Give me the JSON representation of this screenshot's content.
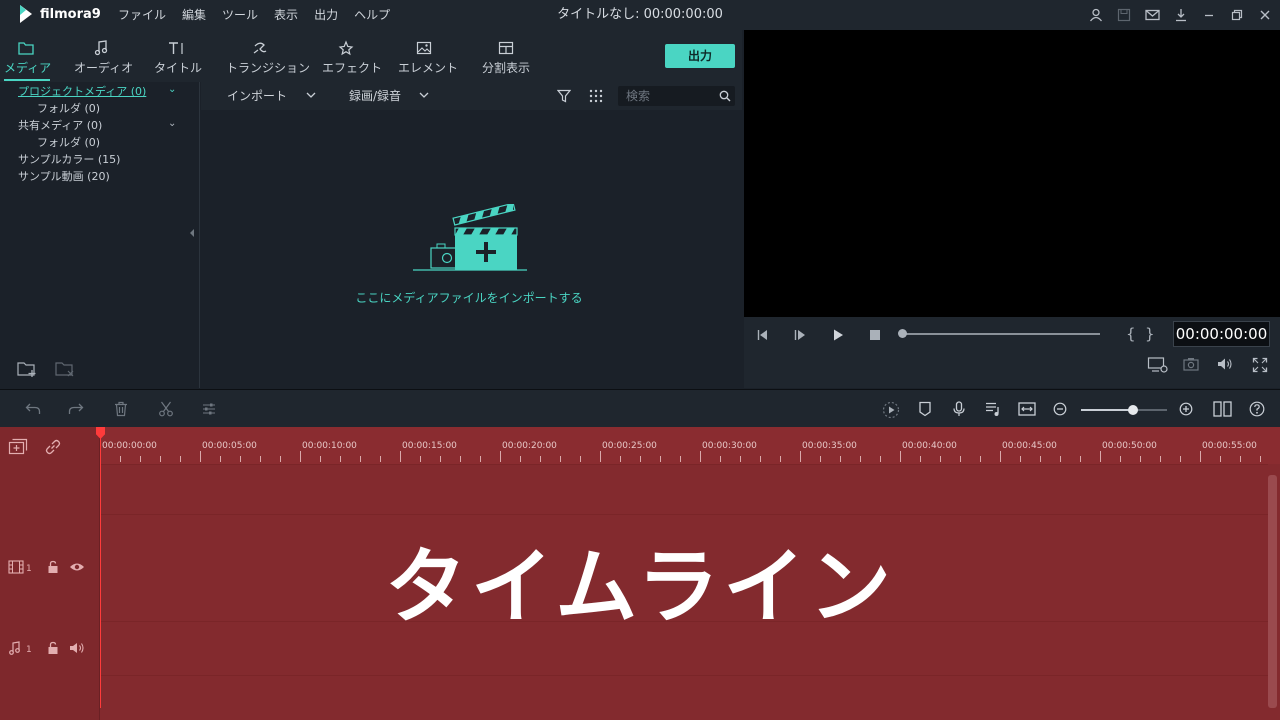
{
  "app": {
    "name": "filmora9",
    "title": "タイトルなし: 00:00:00:00"
  },
  "menu": [
    "ファイル",
    "編集",
    "ツール",
    "表示",
    "出力",
    "ヘルプ"
  ],
  "tabs": [
    {
      "label": "メディア",
      "icon": "folder-icon"
    },
    {
      "label": "オーディオ",
      "icon": "music-note-icon"
    },
    {
      "label": "タイトル",
      "icon": "title-text-icon"
    },
    {
      "label": "トランジション",
      "icon": "transition-icon"
    },
    {
      "label": "エフェクト",
      "icon": "effect-star-icon"
    },
    {
      "label": "エレメント",
      "icon": "image-element-icon"
    },
    {
      "label": "分割表示",
      "icon": "split-screen-icon"
    }
  ],
  "export_label": "出力",
  "tree": [
    {
      "label": "プロジェクトメディア (0)"
    },
    {
      "label": "フォルダ (0)"
    },
    {
      "label": "共有メディア (0)"
    },
    {
      "label": "フォルダ (0)"
    },
    {
      "label": "サンプルカラー (15)"
    },
    {
      "label": "サンプル動画 (20)"
    }
  ],
  "mediabar": {
    "import": "インポート",
    "record": "録画/録音",
    "search_placeholder": "検索"
  },
  "import_hint": "ここにメディアファイルをインポートする",
  "preview": {
    "timecode": "00:00:00:00"
  },
  "ruler": [
    "00:00:00:00",
    "00:00:05:00",
    "00:00:10:00",
    "00:00:15:00",
    "00:00:20:00",
    "00:00:25:00",
    "00:00:30:00",
    "00:00:35:00",
    "00:00:40:00",
    "00:00:45:00",
    "00:00:50:00",
    "00:00:55:00"
  ],
  "tracks": {
    "video": "1",
    "audio": "1"
  },
  "overlay_text": "タイムライン",
  "colors": {
    "accent": "#4ad5c3",
    "timeline": "#832a2e",
    "playhead": "#ff3b3b"
  }
}
